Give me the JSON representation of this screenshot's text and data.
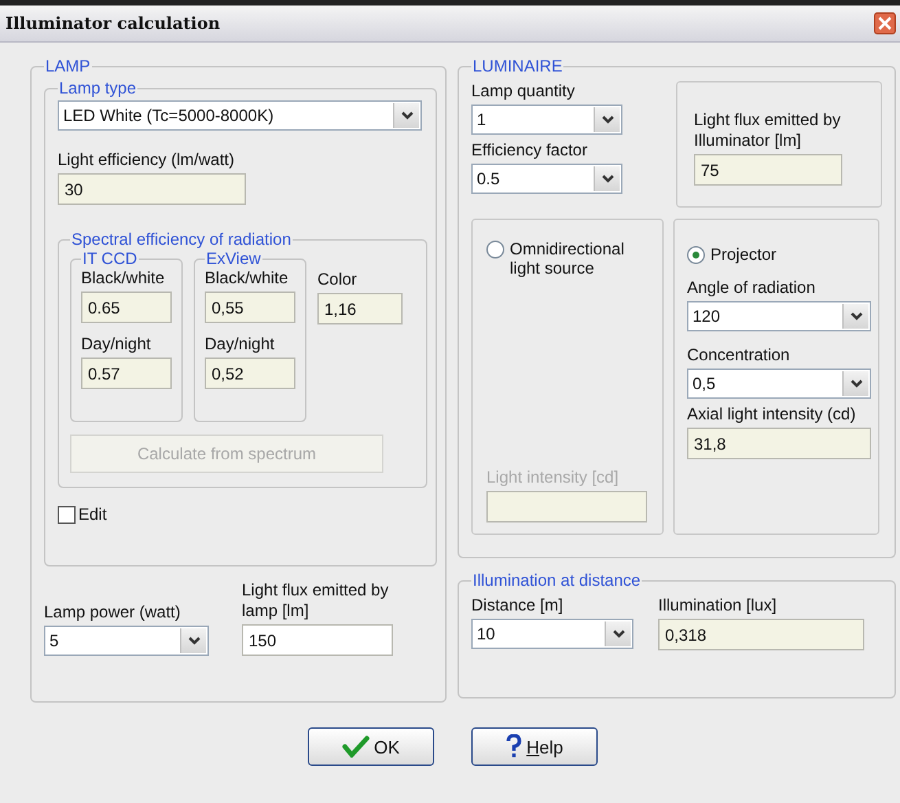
{
  "window": {
    "title": "Illuminator calculation"
  },
  "lamp": {
    "title": "LAMP",
    "lamp_type": {
      "title": "Lamp type",
      "value": "LED White (Tc=5000-8000K)"
    },
    "light_efficiency": {
      "label": "Light efficiency (lm/watt)",
      "value": "30"
    },
    "spectral": {
      "title": "Spectral efficiency of radiation",
      "groups": [
        {
          "title": "IT CCD",
          "bw_label": "Black/white",
          "bw": "0.65",
          "dn_label": "Day/night",
          "dn": "0.57"
        },
        {
          "title": "ExView",
          "bw_label": "Black/white",
          "bw": "0,55",
          "dn_label": "Day/night",
          "dn": "0,52"
        }
      ],
      "color": {
        "label": "Color",
        "value": "1,16"
      },
      "calculate_button": {
        "label": "Calculate from spectrum",
        "disabled": true
      }
    },
    "edit": {
      "label": "Edit",
      "checked": false
    },
    "lamp_power": {
      "label": "Lamp power (watt)",
      "value": "5"
    },
    "lamp_flux": {
      "label": "Light flux emitted by lamp [lm]",
      "value": "150"
    }
  },
  "luminaire": {
    "title": "LUMINAIRE",
    "lamp_quantity": {
      "label": "Lamp quantity",
      "value": "1"
    },
    "efficiency_factor": {
      "label": "Efficiency factor",
      "value": "0.5"
    },
    "illuminator_flux": {
      "label": "Light flux emitted by Illuminator [lm]",
      "value": "75"
    },
    "omnidirectional": {
      "label": "Omnidirectional light source",
      "selected": false,
      "intensity_label": "Light intensity [cd]",
      "disabled": true
    },
    "projector": {
      "label": "Projector",
      "selected": true,
      "angle_label": "Angle of radiation",
      "angle": "120",
      "concentration_label": "Concentration",
      "concentration": "0,5",
      "axial_label": "Axial light intensity (cd)",
      "axial": "31,8"
    }
  },
  "illumination": {
    "title": "Illumination at distance",
    "distance_label": "Distance [m]",
    "distance": "10",
    "illumination_label": "Illumination [lux]",
    "illumination": "0,318"
  },
  "buttons": {
    "ok": "OK",
    "help": "Help"
  }
}
